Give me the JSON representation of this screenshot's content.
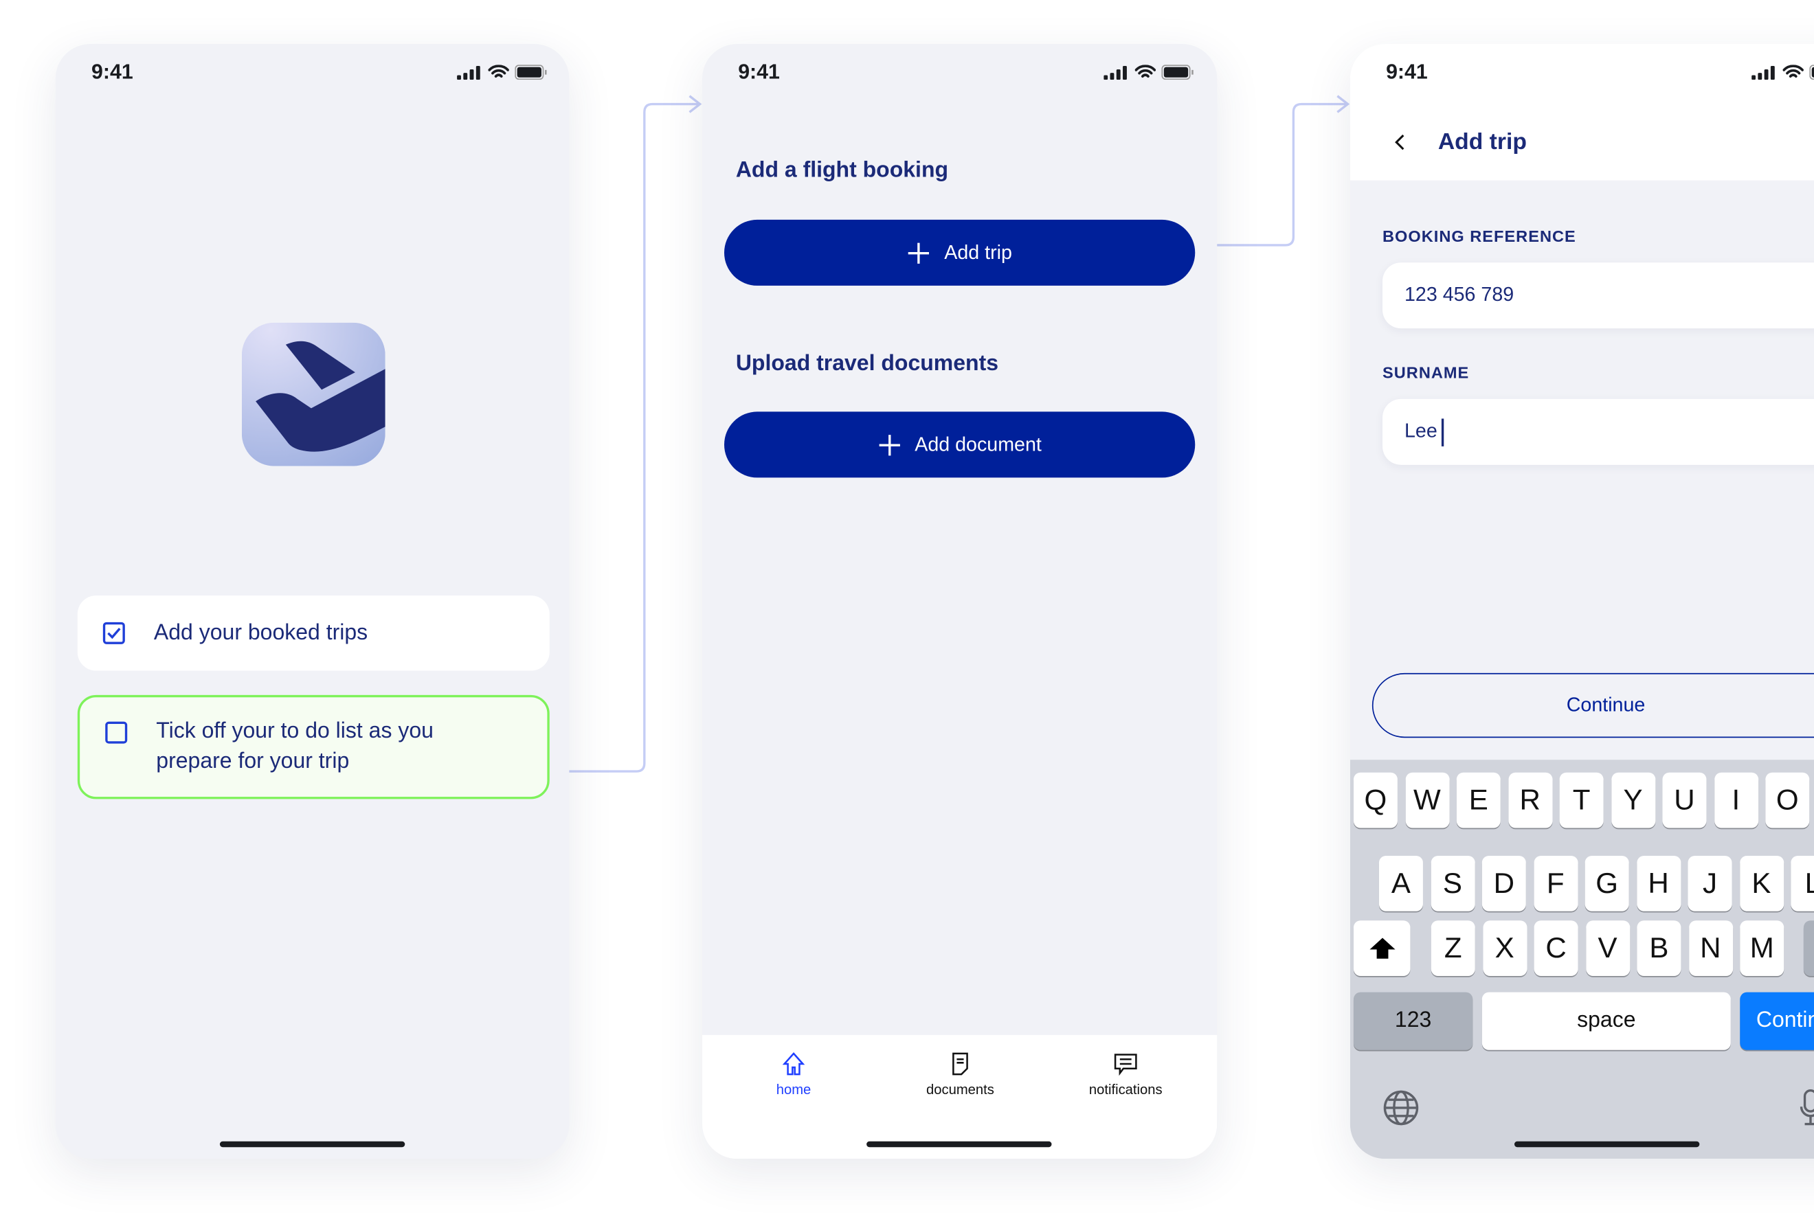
{
  "status_bar": {
    "time": "9:41"
  },
  "screen1": {
    "logo": "airline-app-logo",
    "todo": [
      {
        "label": "Add your booked trips",
        "checked": true
      },
      {
        "label_line1": "Tick off your to do list as you",
        "label_line2": "prepare for your trip",
        "checked": false,
        "highlighted": true
      }
    ]
  },
  "screen2": {
    "sections": [
      {
        "heading": "Add a flight booking",
        "button": "Add trip"
      },
      {
        "heading": "Upload travel documents",
        "button": "Add document"
      }
    ],
    "tabs": [
      {
        "label": "home",
        "icon": "home-icon",
        "active": true
      },
      {
        "label": "documents",
        "icon": "document-icon",
        "active": false
      },
      {
        "label": "notifications",
        "icon": "chat-bubble-icon",
        "active": false
      }
    ]
  },
  "screen3": {
    "title": "Add trip",
    "fields": [
      {
        "label": "BOOKING REFERENCE",
        "value": "123 456 789"
      },
      {
        "label": "SURNAME",
        "value": "Lee"
      }
    ],
    "continue": "Continue",
    "keyboard": {
      "row1": [
        "Q",
        "W",
        "E",
        "R",
        "T",
        "Y",
        "U",
        "I",
        "O"
      ],
      "row2": [
        "A",
        "S",
        "D",
        "F",
        "G",
        "H",
        "J",
        "K",
        "L"
      ],
      "row3": [
        "Z",
        "X",
        "C",
        "V",
        "B",
        "N",
        "M"
      ],
      "numbers": "123",
      "space": "space",
      "return": "Continue"
    }
  },
  "colors": {
    "primary": "#00209a",
    "text": "#1b2a78",
    "highlight_border": "#7ef25a",
    "connector": "#c5cdf5",
    "tab_active": "#1f3fff",
    "keyboard_return": "#0a7cff"
  }
}
